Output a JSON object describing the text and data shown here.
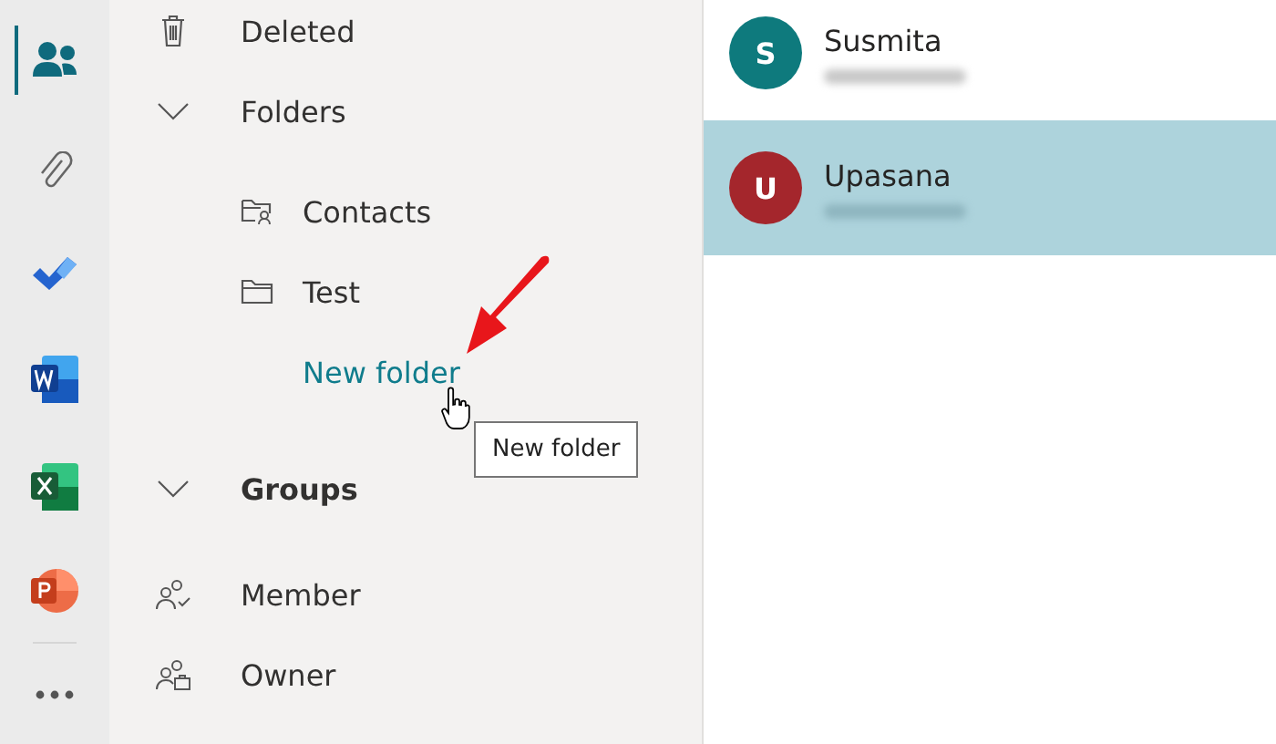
{
  "app_rail": [
    {
      "selected": true
    },
    {
      "selected": false
    },
    {
      "selected": false
    },
    {
      "selected": false
    },
    {
      "selected": false
    },
    {
      "selected": false
    },
    {
      "selected": false
    }
  ],
  "nav": {
    "items": [
      {
        "kind": "item",
        "label": "Deleted"
      },
      {
        "kind": "section",
        "label": "Folders",
        "expanded": true,
        "emphasized": false
      },
      {
        "kind": "folder",
        "label": "Contacts"
      },
      {
        "kind": "folder",
        "label": "Test"
      },
      {
        "kind": "link",
        "label": "New folder"
      },
      {
        "kind": "section",
        "label": "Groups",
        "expanded": true,
        "emphasized": true
      },
      {
        "kind": "item",
        "label": "Member"
      },
      {
        "kind": "item",
        "label": "Owner"
      }
    ]
  },
  "tooltip": {
    "text": "New folder"
  },
  "contacts": [
    {
      "initial": "S",
      "name": "Susmita",
      "color": "#0e7a7d",
      "selected": false
    },
    {
      "initial": "U",
      "name": "Upasana",
      "color": "#a4262c",
      "selected": true
    }
  ]
}
